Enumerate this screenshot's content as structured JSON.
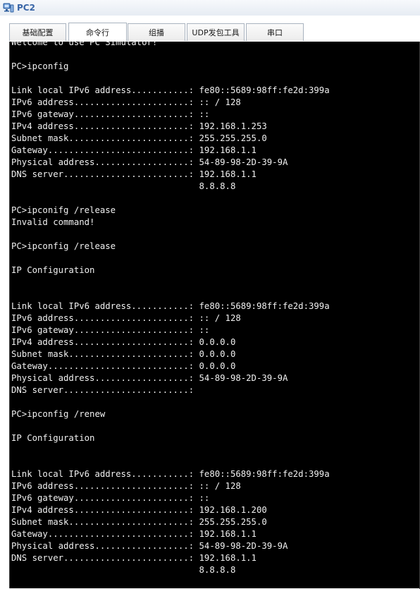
{
  "window": {
    "title": "PC2",
    "icon": "pc-device-icon"
  },
  "tabs": [
    {
      "label": "基础配置",
      "active": false
    },
    {
      "label": "命令行",
      "active": true
    },
    {
      "label": "组播",
      "active": false
    },
    {
      "label": "UDP发包工具",
      "active": false
    },
    {
      "label": "串口",
      "active": false
    }
  ],
  "terminal": {
    "background": "#000000",
    "foreground": "#f0f0f0",
    "lines": [
      "Welcome to use PC Simulator!",
      "",
      "PC>ipconfig",
      "",
      "Link local IPv6 address...........: fe80::5689:98ff:fe2d:399a",
      "IPv6 address......................: :: / 128",
      "IPv6 gateway......................: ::",
      "IPv4 address......................: 192.168.1.253",
      "Subnet mask.......................: 255.255.255.0",
      "Gateway...........................: 192.168.1.1",
      "Physical address..................: 54-89-98-2D-39-9A",
      "DNS server........................: 192.168.1.1",
      "                                    8.8.8.8",
      "",
      "PC>ipconifg /release",
      "Invalid command!",
      "",
      "PC>ipconfig /release",
      "",
      "IP Configuration",
      "",
      "",
      "Link local IPv6 address...........: fe80::5689:98ff:fe2d:399a",
      "IPv6 address......................: :: / 128",
      "IPv6 gateway......................: ::",
      "IPv4 address......................: 0.0.0.0",
      "Subnet mask.......................: 0.0.0.0",
      "Gateway...........................: 0.0.0.0",
      "Physical address..................: 54-89-98-2D-39-9A",
      "DNS server........................:",
      "",
      "PC>ipconfig /renew",
      "",
      "IP Configuration",
      "",
      "",
      "Link local IPv6 address...........: fe80::5689:98ff:fe2d:399a",
      "IPv6 address......................: :: / 128",
      "IPv6 gateway......................: ::",
      "IPv4 address......................: 192.168.1.200",
      "Subnet mask.......................: 255.255.255.0",
      "Gateway...........................: 192.168.1.1",
      "Physical address..................: 54-89-98-2D-39-9A",
      "DNS server........................: 192.168.1.1",
      "                                    8.8.8.8"
    ]
  }
}
